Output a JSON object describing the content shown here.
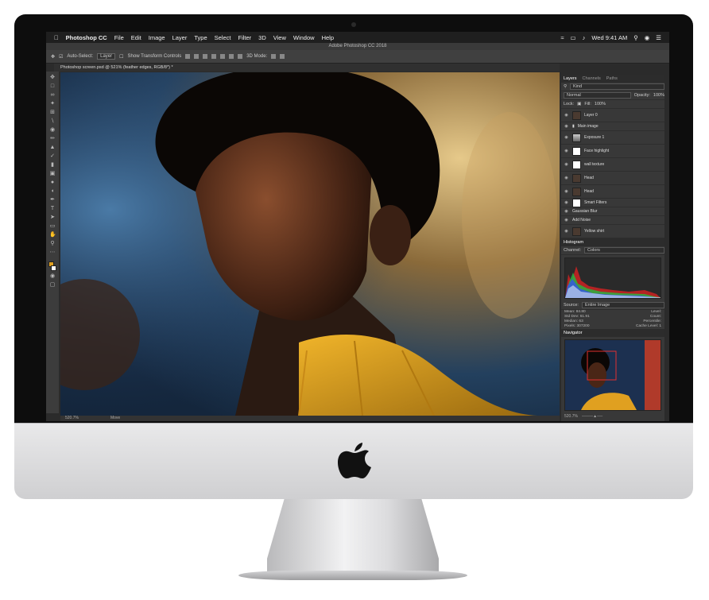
{
  "menubar": {
    "app_name": "Photoshop CC",
    "items": [
      "File",
      "Edit",
      "Image",
      "Layer",
      "Type",
      "Select",
      "Filter",
      "3D",
      "View",
      "Window",
      "Help"
    ],
    "clock": "Wed 9:41 AM"
  },
  "window_title": "Adobe Photoshop CC 2018",
  "options_bar": {
    "auto_select_label": "Auto-Select:",
    "auto_select_value": "Layer",
    "transform_label": "Show Transform Controls",
    "mode_label": "3D Mode:"
  },
  "document_tab": "Photoshop screen.psd @ 521% (feather edges, RGB/8*) *",
  "statusbar": {
    "zoom": "520.7%",
    "tool": "Move"
  },
  "layers_panel": {
    "tabs": [
      "Layers",
      "Channels",
      "Paths"
    ],
    "filter_label": "Kind",
    "blend_mode": "Normal",
    "opacity_label": "Opacity:",
    "opacity_value": "100%",
    "lock_label": "Lock:",
    "fill_label": "Fill:",
    "fill_value": "100%",
    "layers": [
      "Layer 0",
      "Main image",
      "Exposure 1",
      "Face highlight",
      "wall texture",
      "Head",
      "Head",
      "Smart Filters",
      "Gaussian Blur",
      "Add Noise",
      "Yellow shirt"
    ]
  },
  "histogram_panel": {
    "title": "Histogram",
    "channel_label": "Channel:",
    "channel_value": "Colors",
    "source_label": "Source:",
    "source_value": "Entire Image",
    "mean_label": "Mean:",
    "mean_value": "84.80",
    "std_label": "Std Dev:",
    "std_value": "61.91",
    "median_label": "Median:",
    "median_value": "63",
    "pixels_label": "Pixels:",
    "pixels_value": "307200",
    "level_label": "Level:",
    "count_label": "Count:",
    "percentile_label": "Percentile:",
    "cache_label": "Cache Level:",
    "cache_value": "1"
  },
  "navigator_panel": {
    "title": "Navigator",
    "zoom": "520.7%"
  },
  "colors": {
    "accent_yellow": "#e0a020",
    "ui_dark": "#2b2b2b"
  }
}
